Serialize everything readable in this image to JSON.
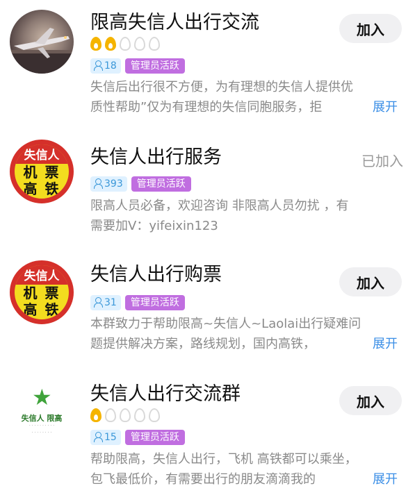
{
  "groups": [
    {
      "title": "限高失信人出行交流",
      "flames_lit": 2,
      "flames_total": 5,
      "members": "18",
      "admin_tag": "管理员活跃",
      "action": "加入",
      "desc_line1": "失信后出行很不方便，为有理想的失信人提供优",
      "desc_line2": "质性帮助”仅为有理想的失信同胞服务，拒",
      "expand": "展开"
    },
    {
      "title": "失信人出行服务",
      "avatar_top": "失信人",
      "avatar_mid": "机 票",
      "avatar_bot": "高 铁",
      "members": "393",
      "admin_tag": "管理员活跃",
      "action": "已加入",
      "desc_line1": "限高人员必备，欢迎咨询 非限高人员勿扰 ，有",
      "desc_line2": "需要加V：yifeixin123"
    },
    {
      "title": "失信人出行购票",
      "avatar_top": "失信人",
      "avatar_mid": "机 票",
      "avatar_bot": "高 铁",
      "members": "31",
      "admin_tag": "管理员活跃",
      "action": "加入",
      "desc_line1": "本群致力于帮助限高~失信人~Laolai出行疑难问",
      "desc_line2": "题提供解决方案，路线规划，国内高铁，",
      "expand": "展开"
    },
    {
      "title": "失信人出行交流群",
      "avatar_name": "失信人 限高",
      "flames_lit": 1,
      "flames_total": 5,
      "members": "15",
      "admin_tag": "管理员活跃",
      "action": "加入",
      "desc_line1": "帮助限高，失信人出行，飞机 高铁都可以乘坐，",
      "desc_line2": "包飞最低价，有需要出行的朋友滴滴我的",
      "expand": "展开"
    }
  ],
  "colors": {
    "accent_link": "#3a8ee6",
    "member_tag_bg": "#dff1ff",
    "admin_tag_bg": "#c06ee0",
    "flame_on": "#f5b400",
    "badge_red": "#d5302a",
    "badge_yellow": "#f3dc1f"
  },
  "icons": {
    "member": "person-icon",
    "activity": "flame-icon",
    "avatar_logo": "star-icon"
  }
}
